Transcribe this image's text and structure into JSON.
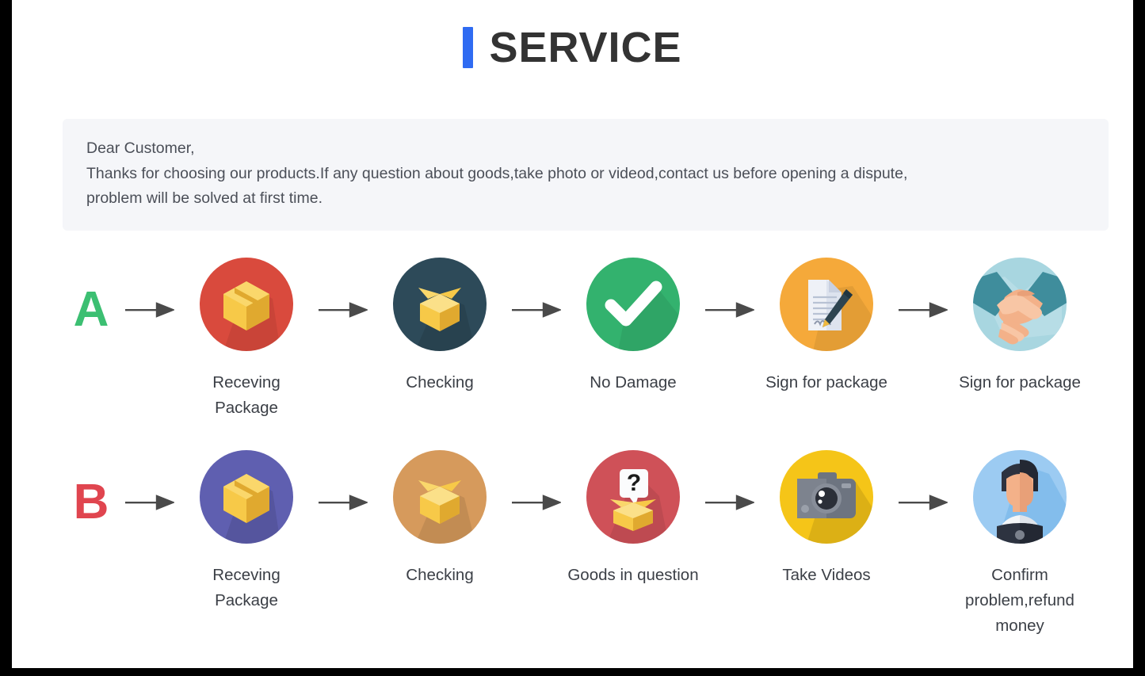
{
  "header": {
    "title": "SERVICE",
    "accent_color": "#2f6bf2"
  },
  "notice": {
    "line1": "Dear Customer,",
    "line2": "Thanks for choosing our products.If any question about goods,take photo or videod,contact us before opening a dispute,",
    "line3": "problem will be solved at first time.",
    "background": "#f5f6f9"
  },
  "flows": [
    {
      "letter": "A",
      "letter_color": "#3cbf72",
      "steps": [
        {
          "label": "Receving Package",
          "icon": "closed-box-icon",
          "circle_color": "#d94a3d"
        },
        {
          "label": "Checking",
          "icon": "open-box-icon",
          "circle_color": "#2d4a59"
        },
        {
          "label": "No Damage",
          "icon": "check-mark-icon",
          "circle_color": "#33b26e"
        },
        {
          "label": "Sign for package",
          "icon": "document-pen-icon",
          "circle_color": "#f5a93a"
        },
        {
          "label": "Sign for package",
          "icon": "handshake-icon",
          "circle_color": "#a8d6e0"
        }
      ]
    },
    {
      "letter": "B",
      "letter_color": "#e0454f",
      "steps": [
        {
          "label": "Receving Package",
          "icon": "closed-box-icon",
          "circle_color": "#5f5fb0"
        },
        {
          "label": "Checking",
          "icon": "open-box-icon",
          "circle_color": "#d69a5c"
        },
        {
          "label": "Goods in question",
          "icon": "question-box-icon",
          "circle_color": "#cf5158"
        },
        {
          "label": "Take Videos",
          "icon": "camera-icon",
          "circle_color": "#f5c518"
        },
        {
          "label": "Confirm problem,refund money",
          "icon": "support-person-icon",
          "circle_color": "#9ccbf2"
        }
      ]
    }
  ],
  "arrow_color": "#4a4a4a"
}
